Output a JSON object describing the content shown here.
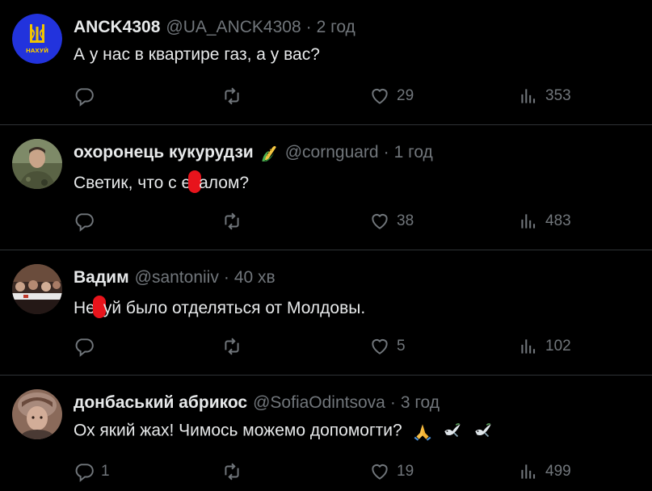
{
  "tweets": [
    {
      "name": "ANCK4308",
      "handle": "@UA_ANCK4308",
      "sep": "·",
      "time": "2 год",
      "text": "А у нас в квартире газ, а у вас?",
      "replies": "",
      "retweets": "",
      "likes": "29",
      "views": "353",
      "avatar_text": "НАХУЙ"
    },
    {
      "name": "охоронець кукурудзи",
      "name_emoji": "🌽",
      "handle": "@cornguard",
      "sep": "·",
      "time": "1 год",
      "text_before": "Светик, что с е",
      "text_after": "алом?",
      "replies": "",
      "retweets": "",
      "likes": "38",
      "views": "483"
    },
    {
      "name": "Вадим",
      "handle": "@santoniiv",
      "sep": "·",
      "time": "40 хв",
      "text_before": "Не",
      "text_after": "уй было отделяться от Молдовы.",
      "replies": "",
      "retweets": "",
      "likes": "5",
      "views": "102"
    },
    {
      "name": "донбаський абрикос",
      "handle": "@SofiaOdintsova",
      "sep": "·",
      "time": "3 год",
      "text": "Ох який жах! Чимось можемо допомогти?",
      "text_emoji": "🙏",
      "replies": "1",
      "retweets": "",
      "likes": "19",
      "views": "499"
    }
  ],
  "icons": {
    "reply": "reply-icon",
    "retweet": "retweet-icon",
    "like": "heart-icon",
    "views": "views-icon"
  },
  "colors": {
    "background": "#000000",
    "text": "#e7e9ea",
    "muted": "#71767b",
    "divider": "#2f3336",
    "censor": "#e8141c",
    "avatar1": "#2233dd",
    "trident": "#f2c500"
  }
}
